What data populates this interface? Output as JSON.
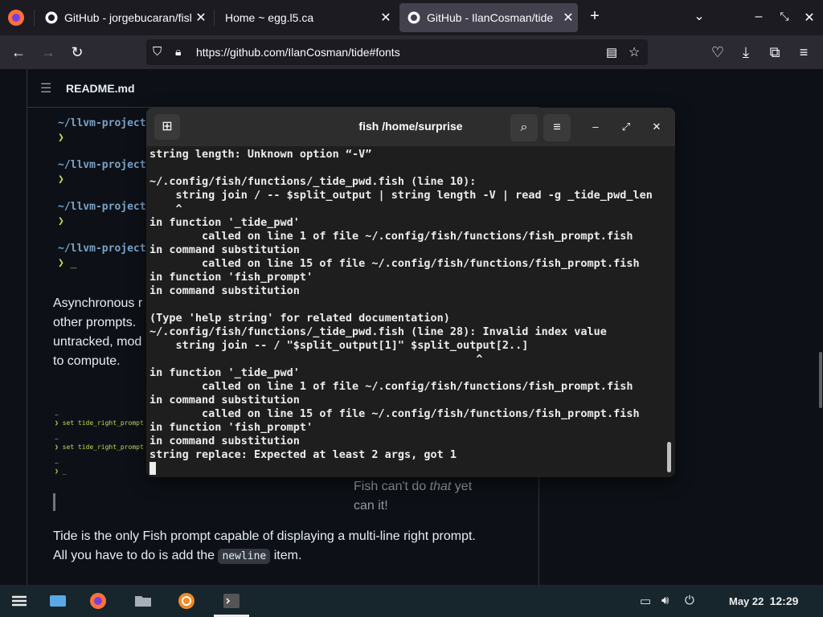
{
  "browser": {
    "tabs": [
      {
        "title": "GitHub - jorgebucaran/fish"
      },
      {
        "title": "Home ~ egg.l5.ca"
      },
      {
        "title": "GitHub - IlanCosman/tide"
      }
    ],
    "url": "https://github.com/IlanCosman/tide#fonts"
  },
  "readme": {
    "header": "README.md",
    "code_lines": [
      "~/llvm-project",
      "~/llvm-project",
      "~/llvm-project",
      "~/llvm-project"
    ],
    "chevron": "❯",
    "cursor_line": "❯ _",
    "para1": [
      "Asynchronous r",
      "other prompts.",
      "untracked, mod",
      "to compute."
    ],
    "mini_lines": [
      "~",
      "❯ set tide_right_prompt",
      "~",
      "❯ set tide_right_prompt",
      "~",
      "❯ _"
    ],
    "caption": [
      "Fish can't do ",
      "that",
      " yet",
      "can it!"
    ],
    "para2_line1": "Tide is the only Fish prompt capable of displaying a multi-line right prompt.",
    "para2_line2_prefix": "All you have to do is add the ",
    "para2_code": "newline",
    "para2_line2_suffix": " item."
  },
  "terminal": {
    "title": "fish /home/surprise",
    "lines": [
      "string length: Unknown option “-V”",
      "",
      "~/.config/fish/functions/_tide_pwd.fish (line 10):",
      "    string join / -- $split_output | string length -V | read -g _tide_pwd_len",
      "    ^",
      "in function '_tide_pwd'",
      "        called on line 1 of file ~/.config/fish/functions/fish_prompt.fish",
      "in command substitution",
      "        called on line 15 of file ~/.config/fish/functions/fish_prompt.fish",
      "in function 'fish_prompt'",
      "in command substitution",
      "",
      "(Type 'help string' for related documentation)",
      "~/.config/fish/functions/_tide_pwd.fish (line 28): Invalid index value",
      "    string join -- / \"$split_output[1]\" $split_output[2..]",
      "                                                  ^",
      "in function '_tide_pwd'",
      "        called on line 1 of file ~/.config/fish/functions/fish_prompt.fish",
      "in command substitution",
      "        called on line 15 of file ~/.config/fish/functions/fish_prompt.fish",
      "in function 'fish_prompt'",
      "in command substitution",
      "string replace: Expected at least 2 args, got 1"
    ]
  },
  "taskbar": {
    "date": "May 22",
    "time": "12:29"
  },
  "colors": {
    "terminal_bg": "#1e1e1e",
    "page_bg": "#0d1117",
    "taskbar_bg": "#16262c"
  }
}
